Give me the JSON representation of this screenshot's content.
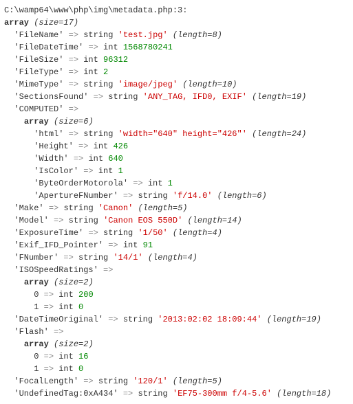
{
  "file_path": "C:\\wamp64\\www\\php\\img\\metadata.php:3:",
  "kw_array": "array",
  "kw_string": "string",
  "kw_int": "int",
  "arrow": "=>",
  "root_size": "(size=17)",
  "entries": {
    "FileName": {
      "key": "'FileName'",
      "val": "'test.jpg'",
      "len": "(length=8)"
    },
    "FileDateTime": {
      "key": "'FileDateTime'",
      "val": "1568780241"
    },
    "FileSize": {
      "key": "'FileSize'",
      "val": "96312"
    },
    "FileType": {
      "key": "'FileType'",
      "val": "2"
    },
    "MimeType": {
      "key": "'MimeType'",
      "val": "'image/jpeg'",
      "len": "(length=10)"
    },
    "SectionsFound": {
      "key": "'SectionsFound'",
      "val": "'ANY_TAG, IFD0, EXIF'",
      "len": "(length=19)"
    },
    "COMPUTED": {
      "key": "'COMPUTED'"
    },
    "Make": {
      "key": "'Make'",
      "val": "'Canon'",
      "len": "(length=5)"
    },
    "Model": {
      "key": "'Model'",
      "val": "'Canon EOS 550D'",
      "len": "(length=14)"
    },
    "ExposureTime": {
      "key": "'ExposureTime'",
      "val": "'1/50'",
      "len": "(length=4)"
    },
    "Exif_IFD_Pointer": {
      "key": "'Exif_IFD_Pointer'",
      "val": "91"
    },
    "FNumber": {
      "key": "'FNumber'",
      "val": "'14/1'",
      "len": "(length=4)"
    },
    "ISOSpeedRatings": {
      "key": "'ISOSpeedRatings'"
    },
    "DateTimeOriginal": {
      "key": "'DateTimeOriginal'",
      "val": "'2013:02:02 18:09:44'",
      "len": "(length=19)"
    },
    "Flash": {
      "key": "'Flash'"
    },
    "FocalLength": {
      "key": "'FocalLength'",
      "val": "'120/1'",
      "len": "(length=5)"
    },
    "UndefinedTag": {
      "key": "'UndefinedTag:0xA434'",
      "val": "'EF75-300mm f/4-5.6'",
      "len": "(length=18)"
    }
  },
  "computed": {
    "size": "(size=6)",
    "html": {
      "key": "'html'",
      "val": "'width=\"640\" height=\"426\"'",
      "len": "(length=24)"
    },
    "Height": {
      "key": "'Height'",
      "val": "426"
    },
    "Width": {
      "key": "'Width'",
      "val": "640"
    },
    "IsColor": {
      "key": "'IsColor'",
      "val": "1"
    },
    "BOM": {
      "key": "'ByteOrderMotorola'",
      "val": "1"
    },
    "AFN": {
      "key": "'ApertureFNumber'",
      "val": "'f/14.0'",
      "len": "(length=6)"
    }
  },
  "iso": {
    "size": "(size=2)",
    "i0": {
      "key": "0",
      "val": "200"
    },
    "i1": {
      "key": "1",
      "val": "0"
    }
  },
  "flash": {
    "size": "(size=2)",
    "i0": {
      "key": "0",
      "val": "16"
    },
    "i1": {
      "key": "1",
      "val": "0"
    }
  }
}
